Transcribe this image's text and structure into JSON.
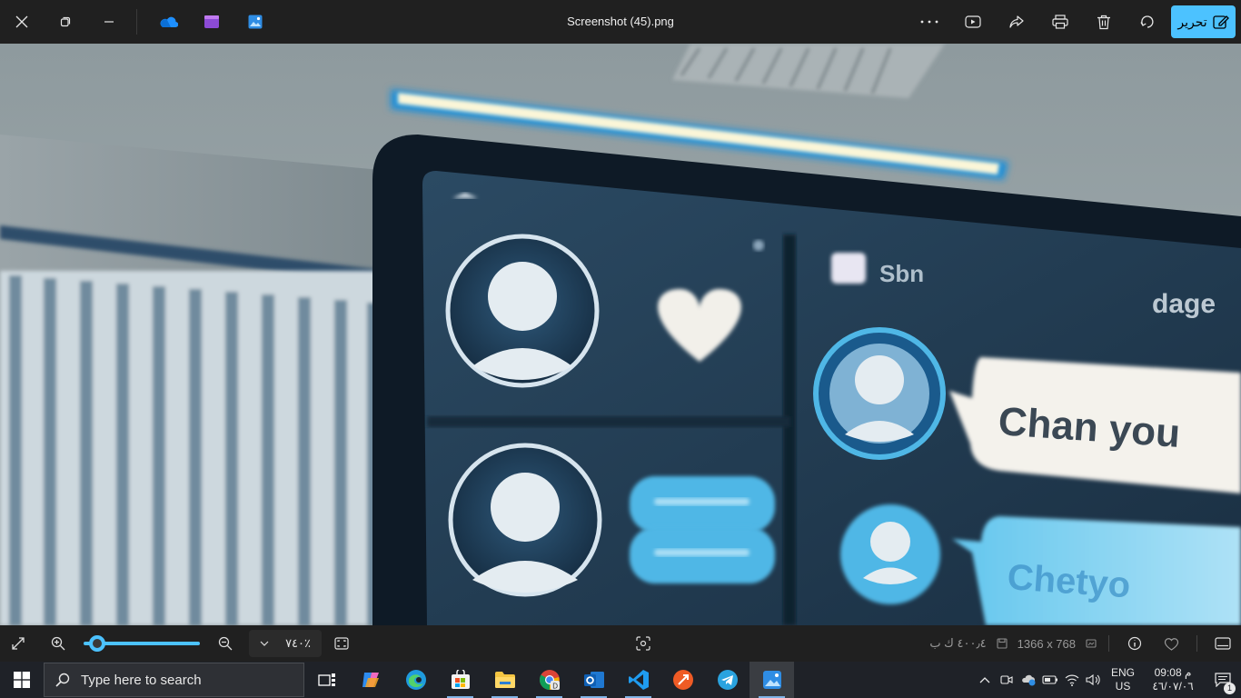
{
  "window": {
    "title": "Screenshot (45).png",
    "edit_label": "تحرير"
  },
  "image": {
    "bubble_1_text": "Chan you",
    "bubble_2_text": "Chetyo",
    "header_text": "Sbn",
    "header_text_right": "dage"
  },
  "statusbar": {
    "zoom_value": "٧٤٠٪",
    "file_size": "٤٠٠٫٤ ك ب",
    "dimensions": "1366 x 768",
    "zoom_level": 0.12
  },
  "taskbar": {
    "search_placeholder": "Type here to search",
    "lang_line1": "ENG",
    "lang_line2": "US",
    "time": "09:08 م",
    "date": "٤٦/٠٧/٠٦",
    "notification_count": "1"
  },
  "colors": {
    "accent": "#4cc2ff",
    "titlebar": "#202020",
    "taskbar": "#1f2228"
  }
}
